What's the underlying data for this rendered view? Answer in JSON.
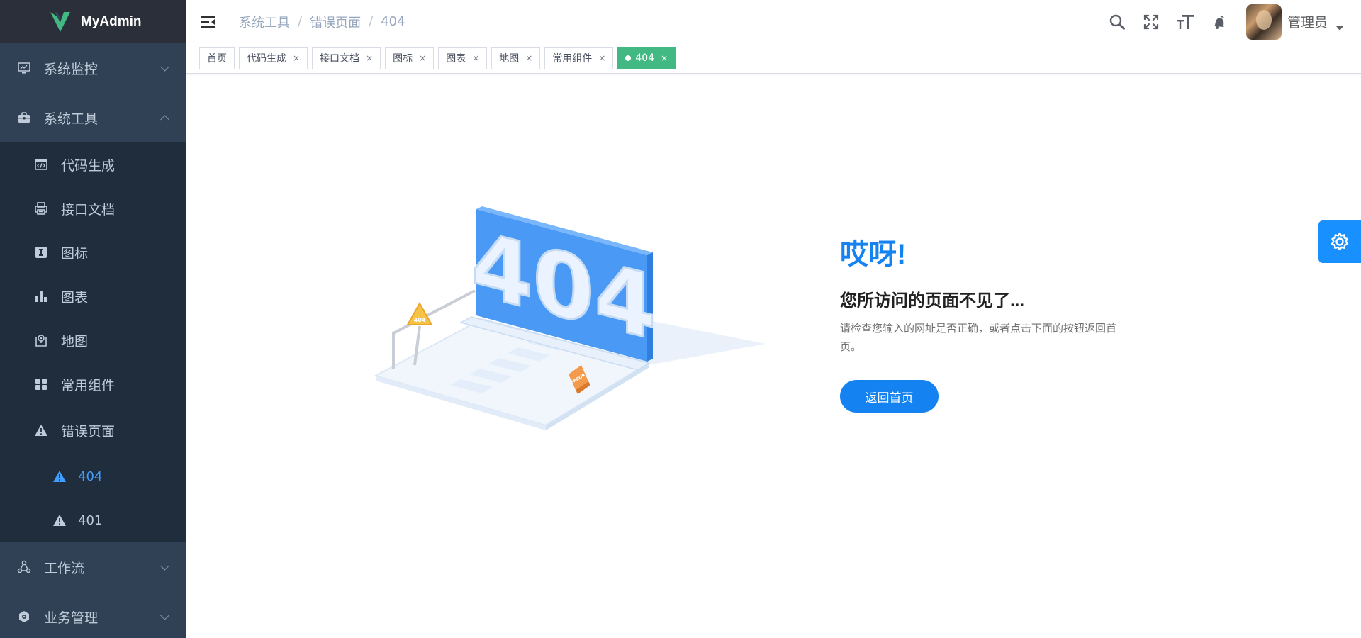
{
  "app": {
    "title": "MyAdmin",
    "brand_color": "#42b983"
  },
  "sidebar": {
    "monitor": {
      "label": "系统监控",
      "icon": "monitor-icon"
    },
    "tool": {
      "label": "系统工具",
      "icon": "toolbox-icon"
    },
    "tool_items": [
      {
        "label": "代码生成",
        "icon": "code-window-icon"
      },
      {
        "label": "接口文档",
        "icon": "printer-icon"
      },
      {
        "label": "图标",
        "icon": "icon-i-icon"
      },
      {
        "label": "图表",
        "icon": "bar-chart-icon"
      },
      {
        "label": "地图",
        "icon": "map-icon"
      },
      {
        "label": "常用组件",
        "icon": "grid-icon"
      }
    ],
    "error": {
      "label": "错误页面",
      "icon": "warning-icon"
    },
    "error_items": [
      {
        "label": "404",
        "icon": "warning-icon",
        "active": true
      },
      {
        "label": "401",
        "icon": "warning-icon",
        "active": false
      }
    ],
    "workflow": {
      "label": "工作流",
      "icon": "workflow-icon"
    },
    "business": {
      "label": "业务管理",
      "icon": "gear-cube-icon"
    }
  },
  "header": {
    "breadcrumb": [
      "系统工具",
      "错误页面",
      "404"
    ],
    "user_name": "管理员",
    "icons": [
      "search-icon",
      "fullscreen-icon",
      "font-size-icon",
      "bell-icon"
    ]
  },
  "tags": [
    {
      "label": "首页",
      "closable": false,
      "active": false
    },
    {
      "label": "代码生成",
      "closable": true,
      "active": false
    },
    {
      "label": "接口文档",
      "closable": true,
      "active": false
    },
    {
      "label": "图标",
      "closable": true,
      "active": false
    },
    {
      "label": "图表",
      "closable": true,
      "active": false
    },
    {
      "label": "地图",
      "closable": true,
      "active": false
    },
    {
      "label": "常用组件",
      "closable": true,
      "active": false
    },
    {
      "label": "404",
      "closable": true,
      "active": true
    }
  ],
  "tag_close_glyph": "×",
  "main": {
    "oops": "哎呀!",
    "headline": "您所访问的页面不见了...",
    "info": "请检查您输入的网址是否正确，或者点击下面的按钮返回首页。",
    "back_button": "返回首页",
    "illustration_text": "404",
    "sign_text": "404",
    "cone_text": "ERROR"
  },
  "colors": {
    "sidebar_bg": "#304156",
    "submenu_bg": "#1f2d3d",
    "active_text": "#409eff",
    "primary": "#1482f0",
    "settings_bg": "#1890ff"
  }
}
